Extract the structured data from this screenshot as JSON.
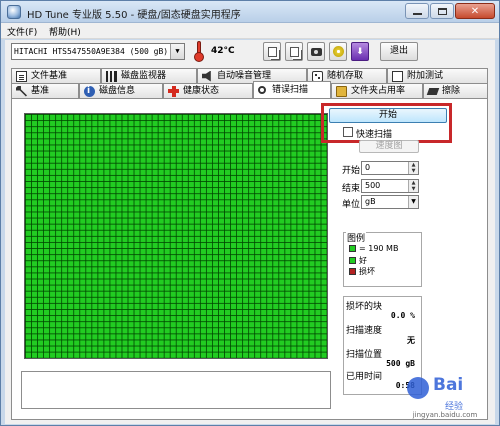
{
  "window": {
    "title": "HD Tune 专业版 5.50 - 硬盘/固态硬盘实用程序"
  },
  "menu": {
    "items": [
      {
        "label": "文件(F)"
      },
      {
        "label": "帮助(H)"
      }
    ]
  },
  "toolbar": {
    "drive": "HITACHI HTS547550A9E384 (500 gB)",
    "temperature": "42°C",
    "buttons": [
      {
        "icon": "copy-text-icon"
      },
      {
        "icon": "copy-screen-icon"
      },
      {
        "icon": "screenshot-icon"
      },
      {
        "icon": "disc-icon"
      },
      {
        "icon": "download-icon"
      }
    ],
    "exit_label": "退出"
  },
  "tabs": {
    "row1": [
      {
        "label": "文件基准",
        "icon": "document-icon"
      },
      {
        "label": "磁盘监视器",
        "icon": "monitor-icon"
      },
      {
        "label": "自动噪音管理",
        "icon": "speaker-icon"
      },
      {
        "label": "随机存取",
        "icon": "dice-icon"
      },
      {
        "label": "附加测试",
        "icon": "page-icon"
      }
    ],
    "row2": [
      {
        "label": "基准",
        "icon": "wrench-icon"
      },
      {
        "label": "磁盘信息",
        "icon": "info-icon"
      },
      {
        "label": "健康状态",
        "icon": "health-cross-icon"
      },
      {
        "label": "错误扫描",
        "icon": "magnifier-icon",
        "active": true
      },
      {
        "label": "文件夹占用率",
        "icon": "folder-icon"
      },
      {
        "label": "擦除",
        "icon": "eraser-icon"
      }
    ]
  },
  "scan": {
    "start_label": "开始",
    "quick_scan_label": "快速扫描",
    "quick_scan_checked": false,
    "map_label": "速度图",
    "start_field_label": "开始",
    "start_value": "0",
    "end_field_label": "结束",
    "end_value": "500",
    "unit_label": "单位",
    "unit_value": "gB",
    "legend": {
      "title": "图例",
      "block_size": "= 190 MB",
      "good_label": "好",
      "bad_label": "损坏",
      "colors": {
        "block": "#22cc22",
        "good": "#22cc22",
        "bad": "#b22222"
      }
    },
    "stats": {
      "damaged_label": "损坏的块",
      "damaged_value": "0.0 %",
      "speed_label": "扫描速度",
      "speed_value": "无",
      "position_label": "扫描位置",
      "position_value": "500 gB",
      "elapsed_label": "已用时间",
      "elapsed_value": "0:58"
    },
    "grid_color": "#22cc22",
    "highlight_color": "#c8282a"
  },
  "watermark": {
    "brand": "Bai",
    "sub": "经验",
    "url": "jingyan.baidu.com"
  }
}
